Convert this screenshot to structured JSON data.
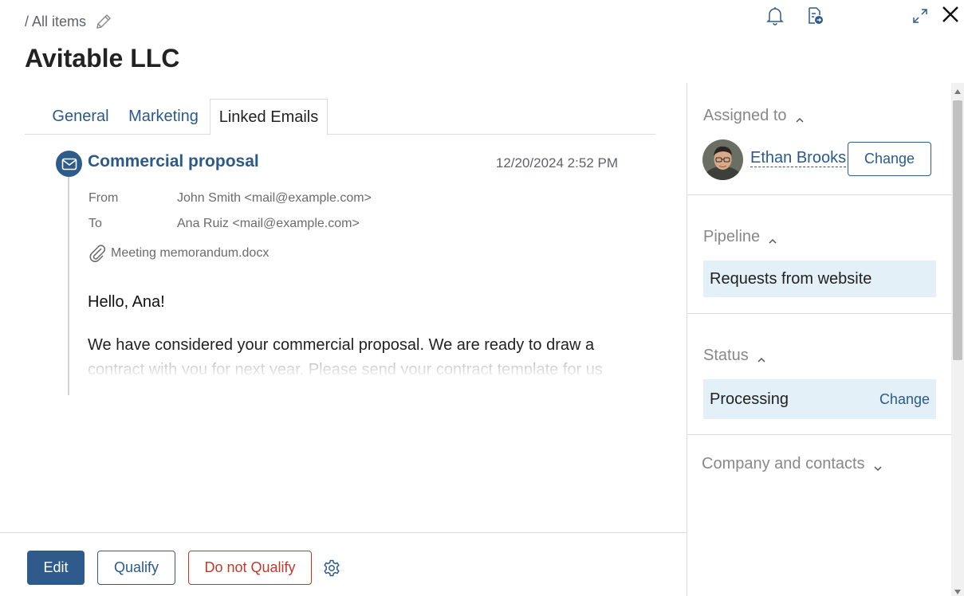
{
  "breadcrumb": {
    "text": "/ All items"
  },
  "page": {
    "title": "Avitable LLC"
  },
  "top_icons": [
    "bell-icon",
    "document-export-icon",
    "expand-icon",
    "close-icon"
  ],
  "tabs": [
    {
      "label": "General"
    },
    {
      "label": "Marketing"
    },
    {
      "label": "Linked Emails",
      "active": true
    }
  ],
  "email": {
    "subject": "Commercial proposal",
    "date": "12/20/2024 2:52 PM",
    "from_label": "From",
    "from_value": "John Smith <mail@example.com>",
    "to_label": "To",
    "to_value": "Ana Ruiz <mail@example.com>",
    "attachment": "Meeting memorandum.docx",
    "greeting": "Hello, Ana!",
    "body": "We have considered your commercial proposal. We are ready to draw a contract with you for next year. Please send your contract template for us"
  },
  "actions": {
    "edit": "Edit",
    "qualify": "Qualify",
    "do_not_qualify": "Do not Qualify"
  },
  "sidebar": {
    "assigned": {
      "header": "Assigned to",
      "name": "Ethan Brooks",
      "change": "Change"
    },
    "pipeline": {
      "header": "Pipeline",
      "value": "Requests from website"
    },
    "status": {
      "header": "Status",
      "value": "Processing",
      "change": "Change"
    },
    "company": {
      "header": "Company and contacts"
    }
  },
  "colors": {
    "accent": "#2e5b8c",
    "link": "#2b5a8a",
    "danger": "#c0392b",
    "field_bg": "#e3f0f8"
  }
}
